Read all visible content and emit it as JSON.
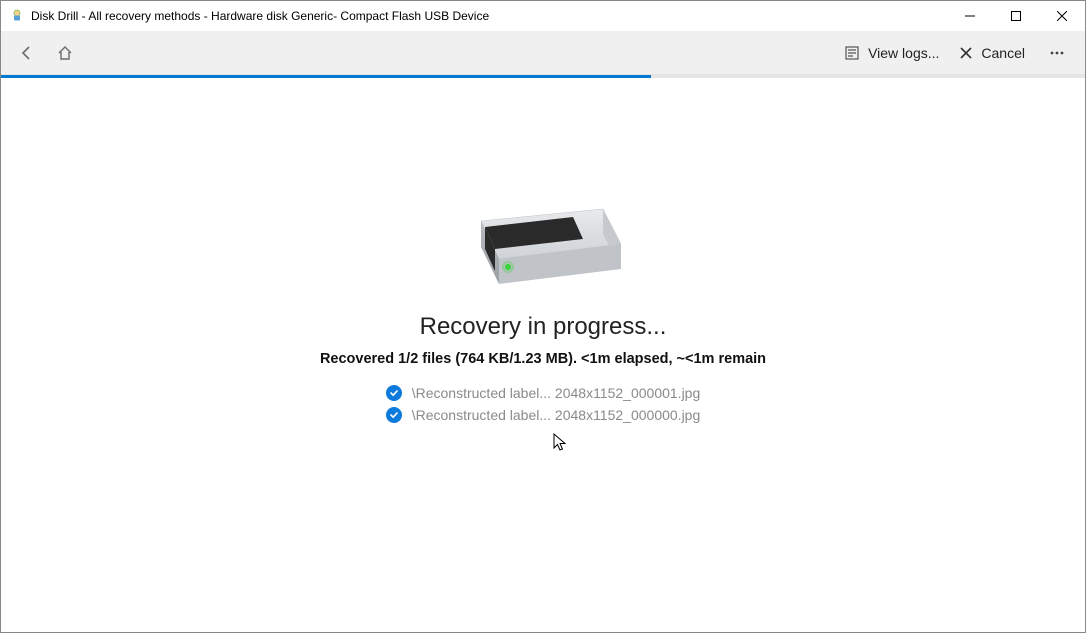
{
  "window": {
    "title": "Disk Drill - All recovery methods - Hardware disk Generic- Compact Flash USB Device"
  },
  "toolbar": {
    "view_logs_label": "View logs...",
    "cancel_label": "Cancel"
  },
  "progress": {
    "percent": 60
  },
  "main": {
    "headline": "Recovery in progress...",
    "status": "Recovered 1/2 files (764 KB/1.23 MB).  <1m elapsed,  ~<1m remain",
    "files": [
      {
        "path": "\\Reconstructed label... 2048x1152_000001.jpg"
      },
      {
        "path": "\\Reconstructed label... 2048x1152_000000.jpg"
      }
    ]
  }
}
